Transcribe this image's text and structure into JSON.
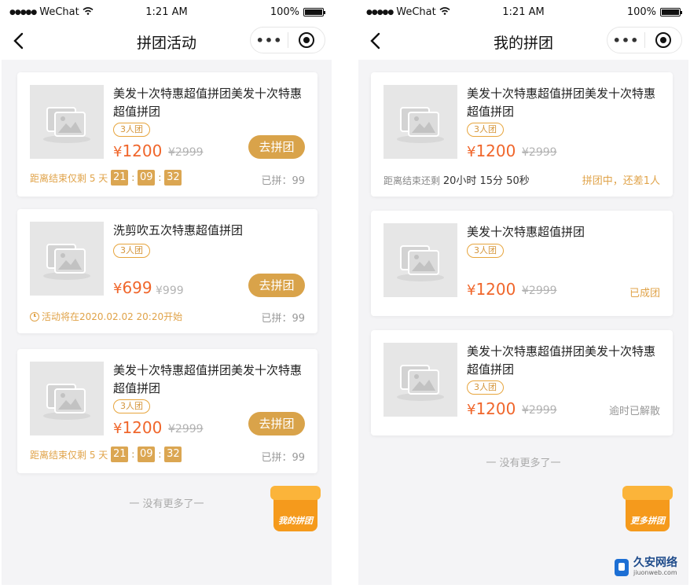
{
  "statusbar": {
    "carrier": "WeChat",
    "time": "1:21 AM",
    "battery": "100%"
  },
  "colors": {
    "accent": "#d9a34a",
    "price": "#f0662b",
    "tag": "#e7a53d",
    "bg": "#f4f4f6"
  },
  "left": {
    "nav_title": "拼团活动",
    "cards": [
      {
        "title": "美发十次特惠超值拼团美发十次特惠超值拼团",
        "tag": "3人团",
        "currency": "¥",
        "price": "1200",
        "orig_price": "¥2999",
        "button": "去拼团",
        "countdown_label": "距离结束仅剩 5 天",
        "cd_h": "21",
        "cd_m": "09",
        "cd_s": "32",
        "joined": "已拼：99"
      },
      {
        "title": "洗剪吹五次特惠超值拼团",
        "tag": "3人团",
        "currency": "¥",
        "price": "699",
        "orig_price": "¥999",
        "button": "去拼团",
        "start_text": "活动将在2020.02.02 20:20开始",
        "joined": "已拼：99"
      },
      {
        "title": "美发十次特惠超值拼团美发十次特惠超值拼团",
        "tag": "3人团",
        "currency": "¥",
        "price": "1200",
        "orig_price": "¥2999",
        "button": "去拼团",
        "countdown_label": "距离结束仅剩 5 天",
        "cd_h": "21",
        "cd_m": "09",
        "cd_s": "32",
        "joined": "已拼：99"
      }
    ],
    "footer": "一 没有更多了一",
    "float_label": "我的拼团"
  },
  "right": {
    "nav_title": "我的拼团",
    "cards": [
      {
        "title": "美发十次特惠超值拼团美发十次特惠超值拼团",
        "tag": "3人团",
        "currency": "¥",
        "price": "1200",
        "orig_price": "¥2999",
        "remain_label": "距离结束还剩",
        "remain_value": "20小时 15分 50秒",
        "status": "拼团中，还差1人"
      },
      {
        "title": "美发十次特惠超值拼团",
        "tag": "3人团",
        "currency": "¥",
        "price": "1200",
        "orig_price": "¥2999",
        "status": "已成团"
      },
      {
        "title": "美发十次特惠超值拼团美发十次特惠超值拼团",
        "tag": "3人团",
        "currency": "¥",
        "price": "1200",
        "orig_price": "¥2999",
        "status": "逾时已解散"
      }
    ],
    "footer": "一 没有更多了一",
    "float_label": "更多拼团"
  },
  "watermark": {
    "cn": "久安网络",
    "en": "jiuonweb.com"
  }
}
